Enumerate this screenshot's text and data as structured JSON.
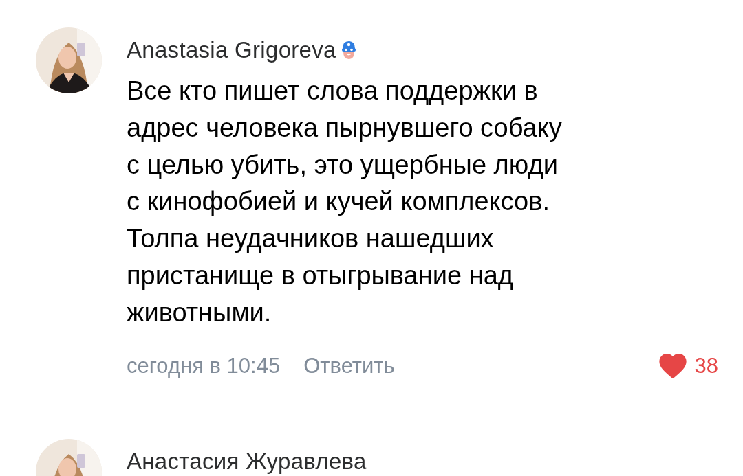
{
  "comments": [
    {
      "author": "Anastasia Grigoreva",
      "badge": true,
      "text": "Все кто пишет слова поддержки в\nадрес человека пырнувшего собаку\nс целью убить, это ущербные люди\nс кинофобией и кучей комплексов.\nТолпа неудачников нашедших\nпристанище в отыгрывание над\nживотными.",
      "time": "сегодня в 10:45",
      "reply": "Ответить",
      "liked": true,
      "likes": "38"
    },
    {
      "author": "Анастасия Журавлева",
      "badge": false
    }
  ]
}
